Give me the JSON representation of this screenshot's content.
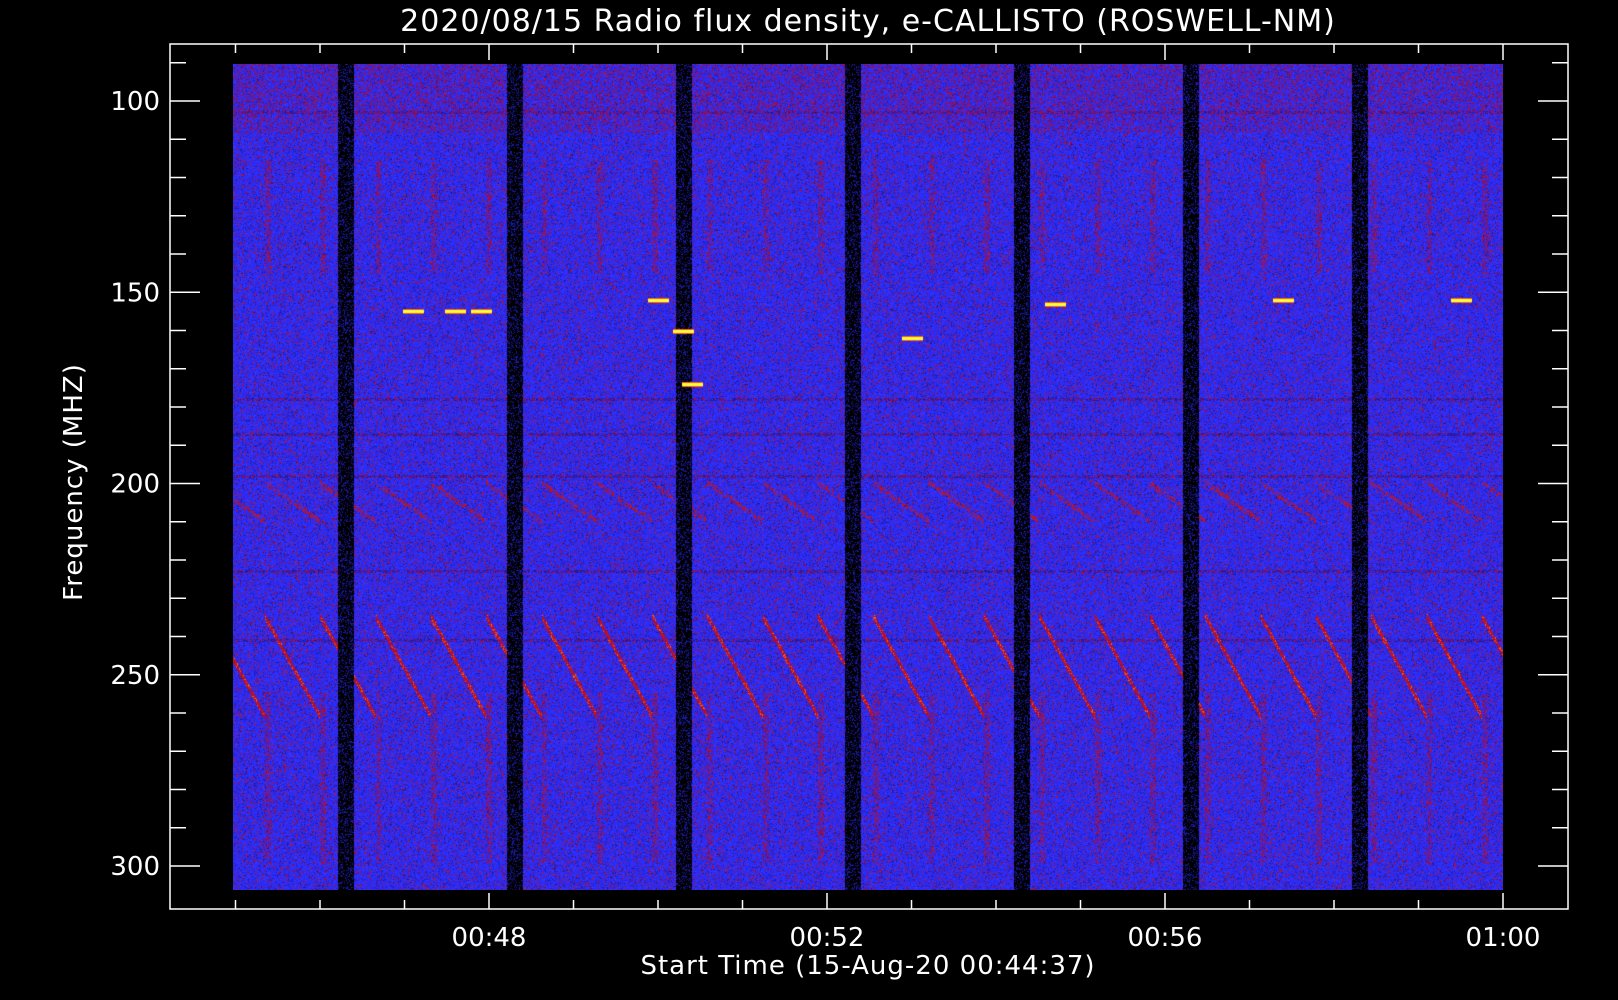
{
  "chart_data": {
    "type": "heatmap",
    "title": "2020/08/15  Radio flux density, e-CALLISTO (ROSWELL-NM)",
    "xlabel": "Start Time (15-Aug-20 00:44:37)",
    "ylabel": "Frequency (MHZ)",
    "x_ticks": [
      "00:48",
      "00:52",
      "00:56",
      "01:00"
    ],
    "x_tick_minutes": [
      48,
      52,
      56,
      60
    ],
    "y_ticks": [
      "100",
      "150",
      "200",
      "250",
      "300"
    ],
    "y_tick_values": [
      100,
      150,
      200,
      250,
      300
    ],
    "xlim_minutes": [
      44.62,
      60.0
    ],
    "ylim_mhz": [
      90,
      307
    ],
    "y_inverted": true,
    "colormap": [
      "#000000",
      "#1a1aa0",
      "#2a2af0",
      "#3434ff",
      "#8a1060",
      "#c0141c",
      "#ff5a10",
      "#ffff40"
    ],
    "dropout_columns_minutes": [
      46.3,
      48.3,
      50.3,
      52.3,
      54.3,
      56.3,
      58.3
    ],
    "interference_lines_mhz": [
      103,
      178,
      187,
      198,
      223,
      241
    ],
    "drifting_features": {
      "start_mhz": 235,
      "end_mhz": 260,
      "repeat_minutes": 0.67
    },
    "bright_spots": [
      {
        "t": 47.1,
        "f": 155
      },
      {
        "t": 47.6,
        "f": 155
      },
      {
        "t": 47.9,
        "f": 155
      },
      {
        "t": 50.0,
        "f": 152
      },
      {
        "t": 50.3,
        "f": 160
      },
      {
        "t": 50.4,
        "f": 174
      },
      {
        "t": 53.0,
        "f": 162
      },
      {
        "t": 54.7,
        "f": 153
      },
      {
        "t": 57.4,
        "f": 152
      },
      {
        "t": 59.5,
        "f": 152
      }
    ]
  }
}
